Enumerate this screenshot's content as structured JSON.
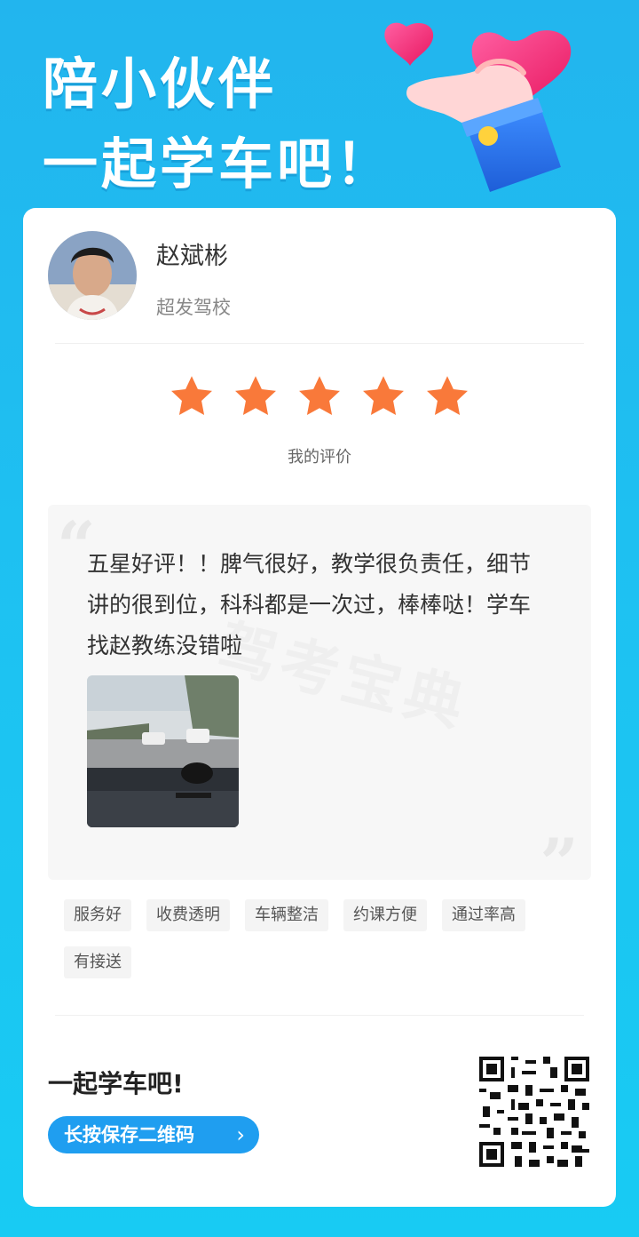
{
  "hero": {
    "line1": "陪小伙伴",
    "line2": "一起学车吧！"
  },
  "coach": {
    "name": "赵斌彬",
    "school": "超发驾校"
  },
  "rating": {
    "stars": 5,
    "max": 5,
    "label": "我的评价",
    "star_color": "#f9793a"
  },
  "review": {
    "text": "五星好评！！脾气很好，教学很负责任，细节讲的很到位，科科都是一次过，棒棒哒！学车找赵教练没错啦",
    "watermark": "驾考宝典"
  },
  "tags": [
    "服务好",
    "收费透明",
    "车辆整洁",
    "约课方便",
    "通过率高",
    "有接送"
  ],
  "footer": {
    "title": "一起学车吧!",
    "button_label": "长按保存二维码"
  },
  "colors": {
    "background": "#1dc3f2",
    "button": "#1f9ef0"
  }
}
